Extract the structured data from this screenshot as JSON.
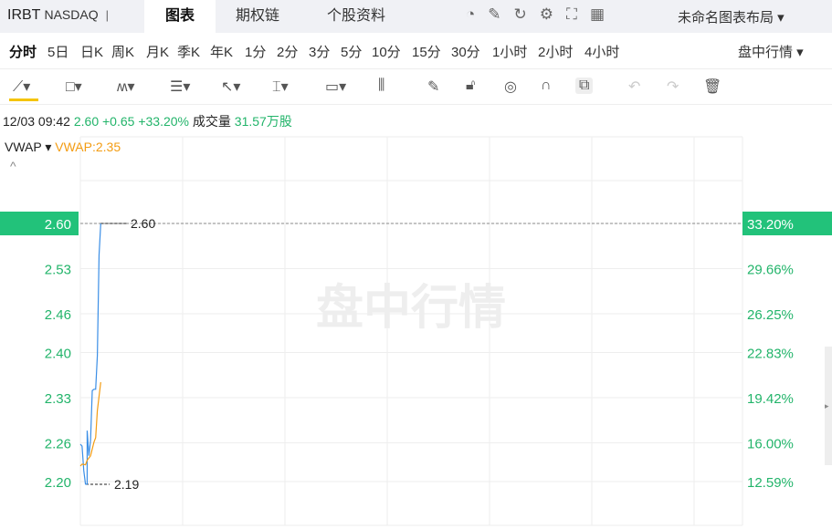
{
  "header": {
    "symbol": "IRBT",
    "exchange": "NASDAQ",
    "separator": "|",
    "tabs": [
      "图表",
      "期权链",
      "个股资料"
    ],
    "icons": [
      "speedometer-icon",
      "pencil-icon",
      "refresh-icon",
      "gear-icon",
      "fullscreen-icon",
      "grid-icon"
    ],
    "layout_label": "未命名图表布局 ▾"
  },
  "periods": {
    "items": [
      "分时",
      "5日",
      "日K",
      "周K",
      "月K",
      "季K",
      "年K",
      "1分",
      "2分",
      "3分",
      "5分",
      "10分",
      "15分",
      "30分",
      "1小时",
      "2小时",
      "4小时"
    ],
    "mode": "盘中行情 ▾"
  },
  "tools": [
    "line-tool",
    "rectangle-tool",
    "pattern-tool",
    "fib-tool",
    "arrow-tool",
    "measure-tool",
    "text-tool",
    "candle-tool",
    "brush-tool",
    "lock-tool",
    "eye-tool",
    "magnet-tool",
    "link-tool",
    "undo-tool",
    "redo-tool",
    "delete-tool"
  ],
  "info": {
    "datetime": "12/03 09:42",
    "price": "2.60",
    "change": "+0.65",
    "change_pct": "+33.20%",
    "volume_label": "成交量",
    "volume": "31.57万股"
  },
  "indicator": {
    "name": "VWAP ▾",
    "value": "VWAP:2.35",
    "collapse": "^"
  },
  "watermark": "盘中行情",
  "colors": {
    "up": "#22b46a",
    "price_line": "#3a8ee6",
    "vwap_line": "#f39c12",
    "accent": "#f5c400"
  },
  "chart_data": {
    "type": "line",
    "y_ticks": [
      "2.60",
      "2.53",
      "2.46",
      "2.40",
      "2.33",
      "2.26",
      "2.20"
    ],
    "y_pct_ticks": [
      "33.20%",
      "29.66%",
      "26.25%",
      "22.83%",
      "19.42%",
      "16.00%",
      "12.59%"
    ],
    "ylim": [
      2.2,
      2.6
    ],
    "high_label": "2.60",
    "low_label": "2.19",
    "current": "2.60",
    "current_pct": "33.20%",
    "series": [
      {
        "key": "price",
        "points": [
          [
            0,
            2.258
          ],
          [
            1,
            2.255
          ],
          [
            2,
            2.217
          ],
          [
            3,
            2.196
          ],
          [
            4,
            2.196
          ],
          [
            4,
            2.279
          ],
          [
            5,
            2.24
          ],
          [
            6,
            2.264
          ],
          [
            7,
            2.341
          ],
          [
            8,
            2.343
          ],
          [
            9,
            2.343
          ],
          [
            10,
            2.395
          ],
          [
            11,
            2.551
          ],
          [
            12,
            2.6
          ]
        ]
      },
      {
        "key": "vwap",
        "points": [
          [
            0,
            2.224
          ],
          [
            1,
            2.227
          ],
          [
            3,
            2.226
          ],
          [
            4,
            2.233
          ],
          [
            6,
            2.24
          ],
          [
            8,
            2.261
          ],
          [
            9,
            2.268
          ],
          [
            10,
            2.31
          ],
          [
            12,
            2.354
          ]
        ]
      }
    ]
  }
}
